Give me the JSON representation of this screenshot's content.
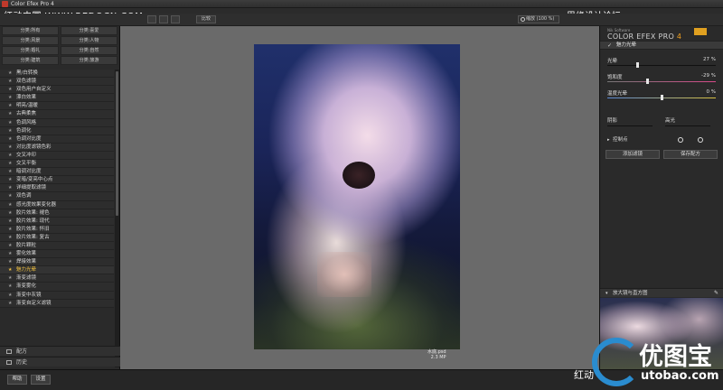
{
  "window": {
    "title": "Color Efex Pro 4"
  },
  "watermarks": {
    "left": "红动中国 WWW.REDOCN.COM",
    "right": "思缘设计论坛 WWW.MISSYUAN.COM",
    "logo_cn": "优图宝",
    "logo_url": "utobao.com",
    "bottom": "红动"
  },
  "toolbar": {
    "compare_label": "比较",
    "zoom_label": "缩放 (100 %)"
  },
  "categories": [
    "分类:所有",
    "分类:喜爱",
    "分类:风景",
    "分类:人物",
    "分类:婚礼",
    "分类:自然",
    "分类:建筑",
    "分类:旅游"
  ],
  "filters": [
    "黑/白转换",
    "双色滤镜",
    "双色用户自定义",
    "漂白效果",
    "明亮/温暖",
    "古典柔焦",
    "色调风格",
    "色调化",
    "色调对比度",
    "对比度滤镜色彩",
    "交叉冲印",
    "交叉平衡",
    "暗调对比度",
    "变暗/变亮中心点",
    "详细提取滤镜",
    "双色调",
    "感光度效果变化器",
    "胶片效果: 褪色",
    "胶片效果: 现代",
    "胶片效果: 怀旧",
    "胶片效果: 复古",
    "胶片颗粒",
    "雾化效果",
    "焊接效果",
    "魅力光晕",
    "渐变滤镜",
    "渐变雾化",
    "渐变中灰镜",
    "渐变自定义滤镜"
  ],
  "active_filter_index": 24,
  "sidebar_sections": {
    "history_recipes": "配方",
    "history": "历史"
  },
  "bottom_buttons": {
    "help": "帮助",
    "settings": "设置"
  },
  "photo": {
    "filename": "水底.psd",
    "size": "2.3 MP"
  },
  "right_panel": {
    "brand_small": "Nik Software",
    "brand_main": "COLOR EFEX PRO",
    "brand_version": "4",
    "filter_title": "魅力光晕",
    "sliders": [
      {
        "label": "光晕",
        "value": "27 %",
        "position": 0.27
      },
      {
        "label": "饱和度",
        "value": "-29 %",
        "position": 0.36
      },
      {
        "label": "温度光晕",
        "value": "0 %",
        "position": 0.5
      }
    ],
    "shadows_label": "阴影",
    "highlights_label": "高光",
    "control_points_label": "控制点",
    "add_filter_label": "添加滤镜",
    "save_recipe_label": "保存配方",
    "loupe_label": "放大镜与直方图"
  }
}
